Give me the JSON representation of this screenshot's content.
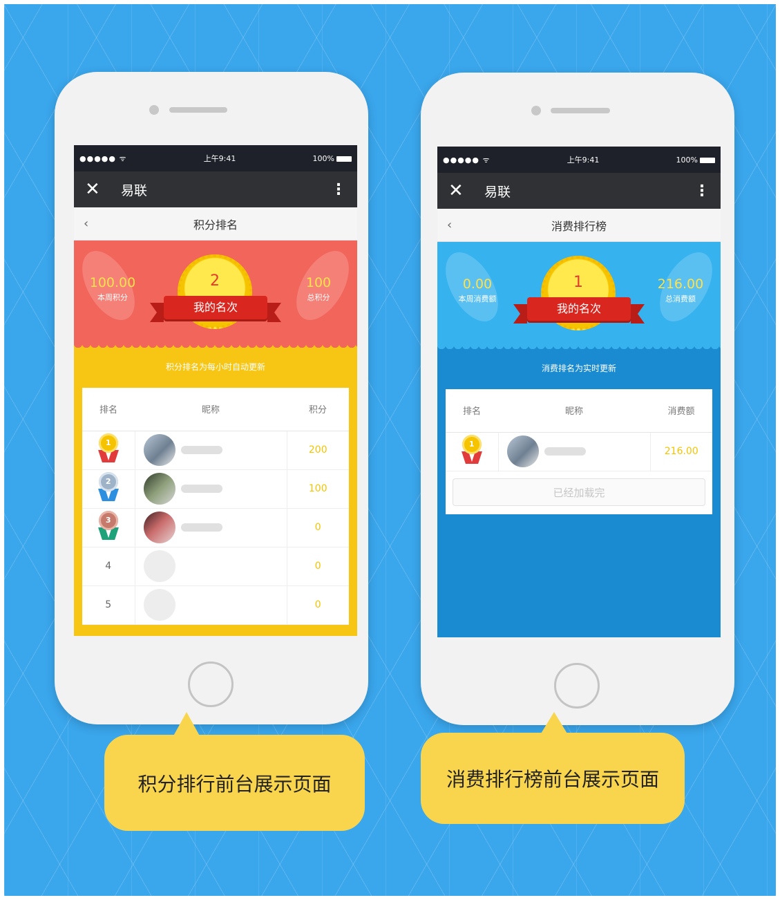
{
  "left_phone": {
    "status": {
      "signal": "●●●●● ᯤ",
      "time": "上午9:41",
      "battery": "100%"
    },
    "app_title": "易联",
    "page_title": "积分排名",
    "hero": {
      "my_rank": "2",
      "my_rank_label": "我的名次",
      "left_value": "100.00",
      "left_label": "本周积分",
      "right_value": "100",
      "right_label": "总积分"
    },
    "notice": "积分排名为每小时自动更新",
    "table": {
      "headers": [
        "排名",
        "昵称",
        "积分"
      ],
      "rows": [
        {
          "rank": "1",
          "score": "200"
        },
        {
          "rank": "2",
          "score": "100"
        },
        {
          "rank": "3",
          "score": "0"
        },
        {
          "rank": "4",
          "score": "0"
        },
        {
          "rank": "5",
          "score": "0"
        }
      ]
    }
  },
  "right_phone": {
    "status": {
      "signal": "●●●●● ᯤ",
      "time": "上午9:41",
      "battery": "100%"
    },
    "app_title": "易联",
    "page_title": "消费排行榜",
    "hero": {
      "my_rank": "1",
      "my_rank_label": "我的名次",
      "left_value": "0.00",
      "left_label": "本周消费额",
      "right_value": "216.00",
      "right_label": "总消费额"
    },
    "notice": "消费排名为实时更新",
    "table": {
      "headers": [
        "排名",
        "昵称",
        "消费额"
      ],
      "rows": [
        {
          "rank": "1",
          "score": "216.00"
        }
      ]
    },
    "loaded_text": "已经加载完"
  },
  "captions": {
    "left": "积分排行前台展示页面",
    "right": "消费排行榜前台展示页面"
  },
  "colors": {
    "background": "#3aa6ec",
    "red_theme": "#f2655b",
    "yellow_band": "#f7c614",
    "blue_theme": "#36b2ef",
    "dark_blue_band": "#1a8bd0",
    "caption_bubble": "#f9d54e"
  },
  "icons": {
    "close": "close-icon",
    "more": "more-vertical-icon",
    "back": "chevron-left-icon",
    "medal": "medal-icon"
  }
}
